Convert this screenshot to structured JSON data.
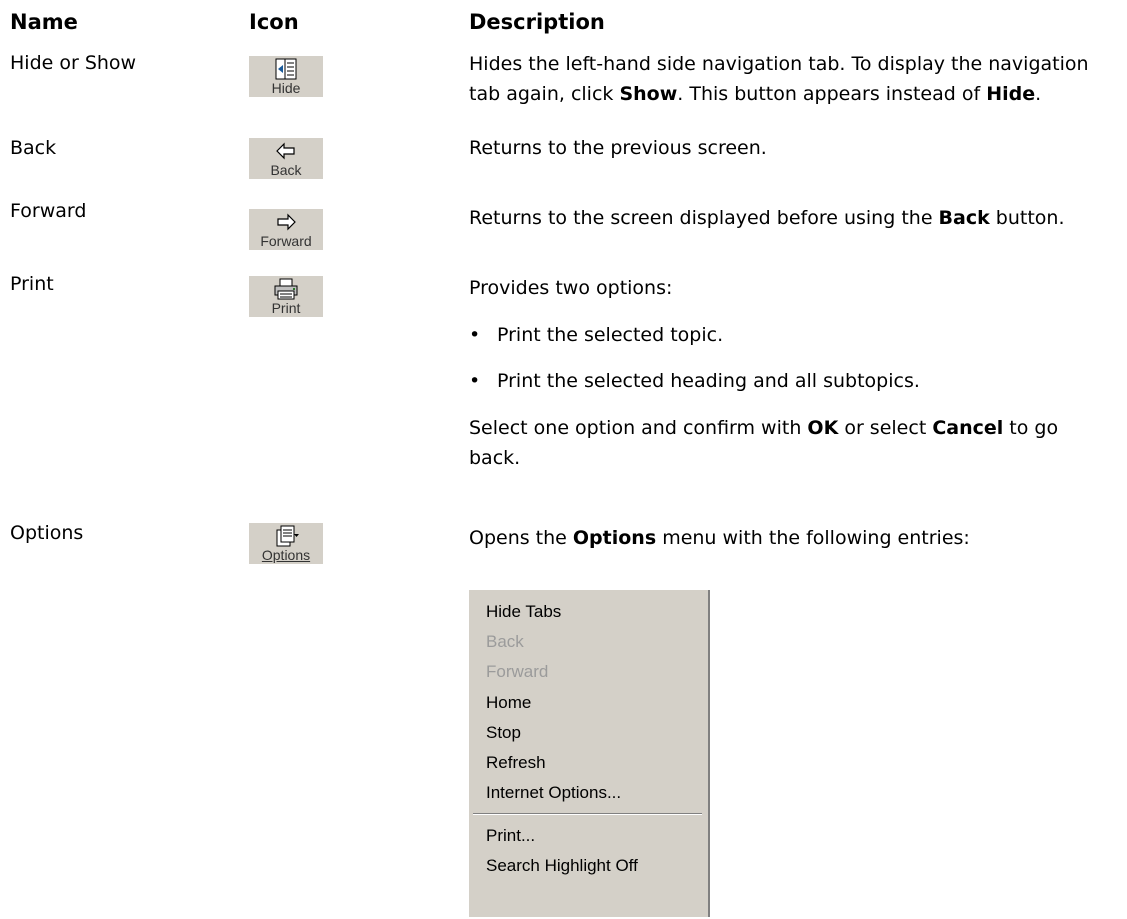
{
  "headers": {
    "name": "Name",
    "icon": "Icon",
    "description": "Description"
  },
  "rows": {
    "hide": {
      "name": "Hide or Show",
      "icon_label": "Hide",
      "icon": "hide-tab-icon",
      "desc": {
        "p1": "Hides the left-hand side navigation tab. To display the navigation",
        "p2": "tab again, click ",
        "b1": "Show",
        "p3": ". This button appears instead of ",
        "b2": "Hide",
        "p4": "."
      }
    },
    "back": {
      "name": "Back",
      "icon_label": "Back",
      "icon": "back-arrow-icon",
      "desc": "Returns to the previous screen."
    },
    "forward": {
      "name": "Forward",
      "icon_label": "Forward",
      "icon": "forward-arrow-icon",
      "desc": {
        "p1": "Returns to the screen displayed before using the ",
        "b1": "Back",
        "p2": " button."
      }
    },
    "print": {
      "name": "Print",
      "icon_label": "Print",
      "icon": "printer-icon",
      "desc": "Provides two options:",
      "bullets": [
        "Print the selected topic.",
        "Print the selected heading and all subtopics."
      ],
      "after": {
        "p1": "Select one option and confirm with ",
        "b1": "OK",
        "p2": " or select ",
        "b2": "Cancel",
        "p3": " to go",
        "p4": "back."
      }
    },
    "options": {
      "name": "Options",
      "icon_label": "Options",
      "icon": "options-icon",
      "desc": {
        "p1": "Opens the ",
        "b1": "Options",
        "p2": " menu with the following entries:"
      }
    }
  },
  "menu": {
    "items": [
      {
        "label": "Hide Tabs",
        "disabled": false
      },
      {
        "label": "Back",
        "disabled": true
      },
      {
        "label": "Forward",
        "disabled": true
      },
      {
        "label": "Home",
        "disabled": false
      },
      {
        "label": "Stop",
        "disabled": false
      },
      {
        "label": "Refresh",
        "disabled": false
      },
      {
        "label": "Internet Options...",
        "disabled": false
      },
      {
        "label": "Print...",
        "disabled": false
      },
      {
        "label": "Search Highlight Off",
        "disabled": false
      }
    ],
    "colors": {
      "background": "#d4d0c8",
      "disabled_text": "#9b9b9b"
    }
  }
}
